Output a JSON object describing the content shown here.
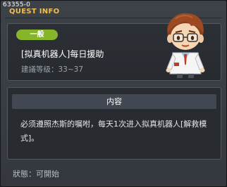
{
  "window": {
    "id": "63355-0",
    "title": "QUEST INFO"
  },
  "quest": {
    "category": "一般",
    "name": "[拟真机器人]每日援助",
    "level_label": "建議等级：",
    "level_range": "33~37"
  },
  "content": {
    "header": "内容",
    "description": "必须遵照杰斯的嘱咐，每天1次进入拟真机器人[解救模式]。"
  },
  "status": {
    "label": "狀態：",
    "value": "可開始"
  },
  "avatar": {
    "icon": "scientist-npc-icon"
  },
  "colors": {
    "title": "#f2c04a",
    "badge": "#86b52a",
    "background": "#3d4249"
  }
}
